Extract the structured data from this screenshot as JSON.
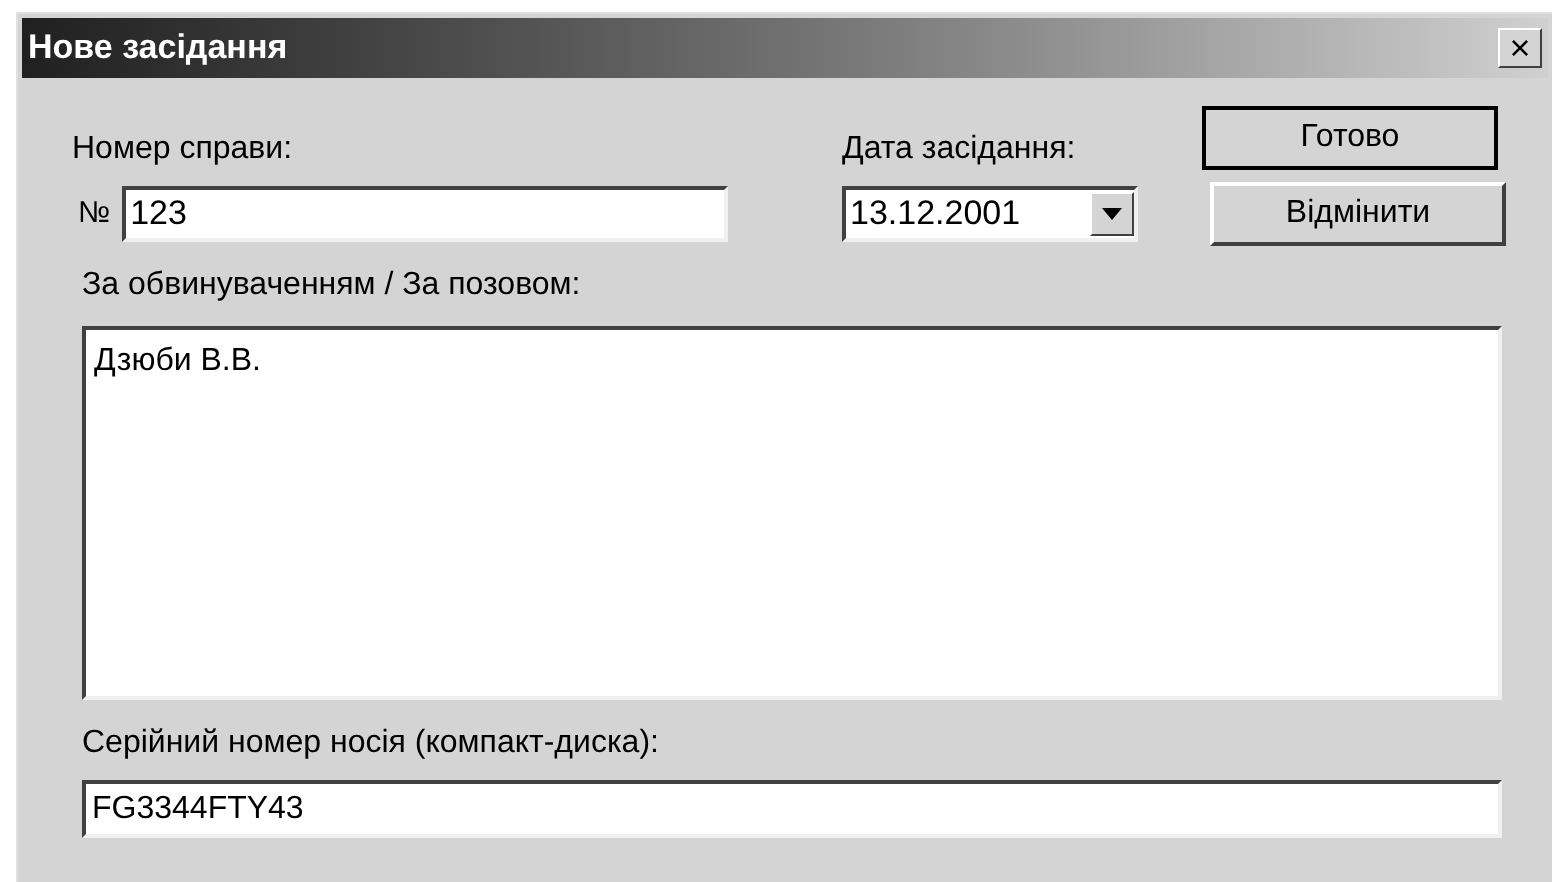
{
  "window": {
    "title": "Нове засідання",
    "close": "×"
  },
  "case_number": {
    "label": "Номер справи:",
    "prefix": "№",
    "value": "123"
  },
  "date": {
    "label": "Дата засідання:",
    "value": "13.12.2001"
  },
  "buttons": [
    {
      "label": "Готово",
      "default": true
    },
    {
      "label": "Відмінити",
      "default": false
    }
  ],
  "parties": {
    "label": "За обвинуваченням / За позовом:",
    "value": "Дзюби В.В."
  },
  "serial": {
    "label": "Серійний номер носія (компакт-диска):",
    "value": "FG3344FTY43"
  }
}
